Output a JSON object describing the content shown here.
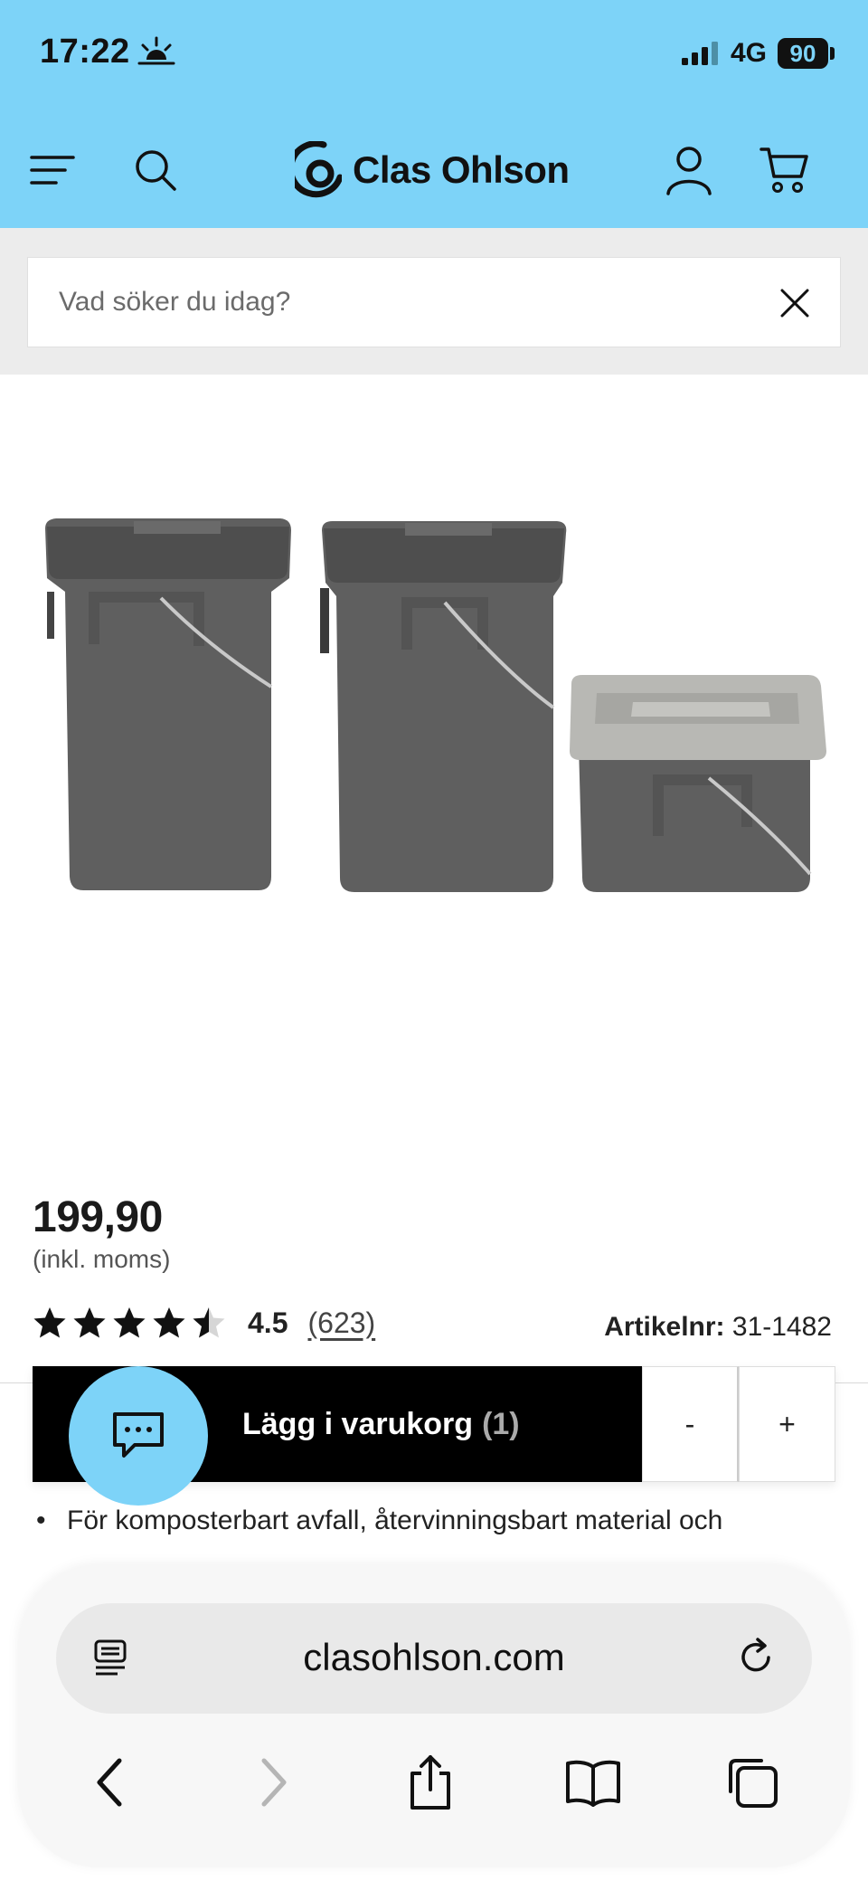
{
  "status_bar": {
    "time": "17:22",
    "network": "4G",
    "battery": "90"
  },
  "header": {
    "brand": "Clas Ohlson"
  },
  "search": {
    "placeholder": "Vad söker du idag?"
  },
  "product": {
    "price": "199,90",
    "price_note": "(inkl. moms)",
    "rating_value": "4.5",
    "rating_count": "(623)",
    "rating_stars": 4.5,
    "article_label": "Artikelnr:",
    "article_number": "31-1482",
    "bullet_text": "För komposterbart avfall, återvinningsbart material och"
  },
  "cart": {
    "add_label": "Lägg i varukorg",
    "quantity": "(1)",
    "minus_label": "-",
    "plus_label": "+"
  },
  "browser": {
    "url": "clasohlson.com"
  },
  "colors": {
    "header_bg": "#7dd3f8",
    "bucket": "#5f5f5f",
    "lid": "#b8b8b4",
    "button_bg": "#000000"
  },
  "icons": [
    "sun-icon",
    "signal-icon",
    "menu-icon",
    "search-icon",
    "account-icon",
    "cart-icon",
    "close-icon",
    "star-icon",
    "chat-icon",
    "reader-icon",
    "reload-icon",
    "back-icon",
    "forward-icon",
    "share-icon",
    "bookmarks-icon",
    "tabs-icon"
  ]
}
